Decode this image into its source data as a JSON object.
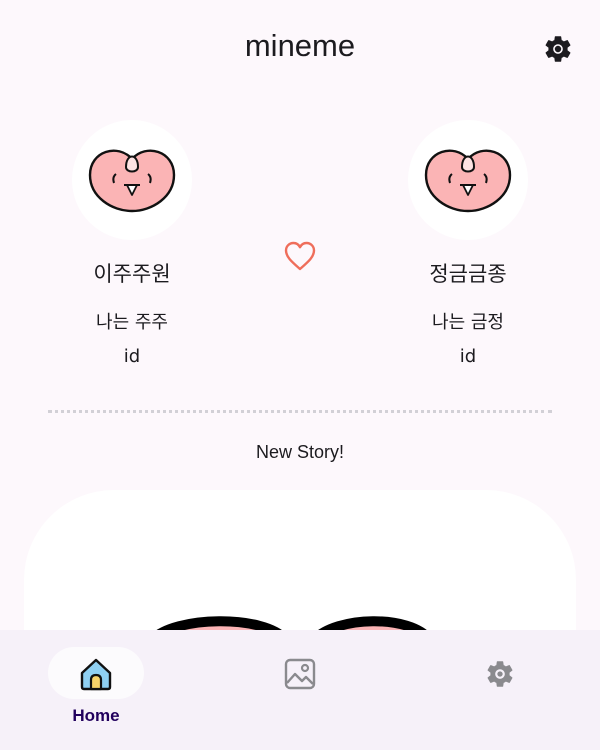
{
  "header": {
    "title": "mineme",
    "settings_icon": "gear-icon"
  },
  "profiles": [
    {
      "name": "이주주원",
      "status": "나는 주주",
      "id": "id",
      "avatar_icon": "peach-character-icon"
    },
    {
      "name": "정금금종",
      "status": "나는 금정",
      "id": "id",
      "avatar_icon": "peach-character-icon"
    }
  ],
  "heart_icon": "heart-outline-icon",
  "story": {
    "title": "New Story!"
  },
  "bottom_nav": {
    "items": [
      {
        "label": "Home",
        "icon": "home-icon",
        "selected": true
      },
      {
        "label": "",
        "icon": "image-icon",
        "selected": false
      },
      {
        "label": "",
        "icon": "gear-icon",
        "selected": false
      }
    ]
  },
  "colors": {
    "background": "#fdf8fc",
    "heart": "#ef6e5b",
    "peach": "#fbb4b5",
    "nav_label": "#21005d",
    "home_icon": "#8fd0f2",
    "home_door": "#f7d46a"
  }
}
